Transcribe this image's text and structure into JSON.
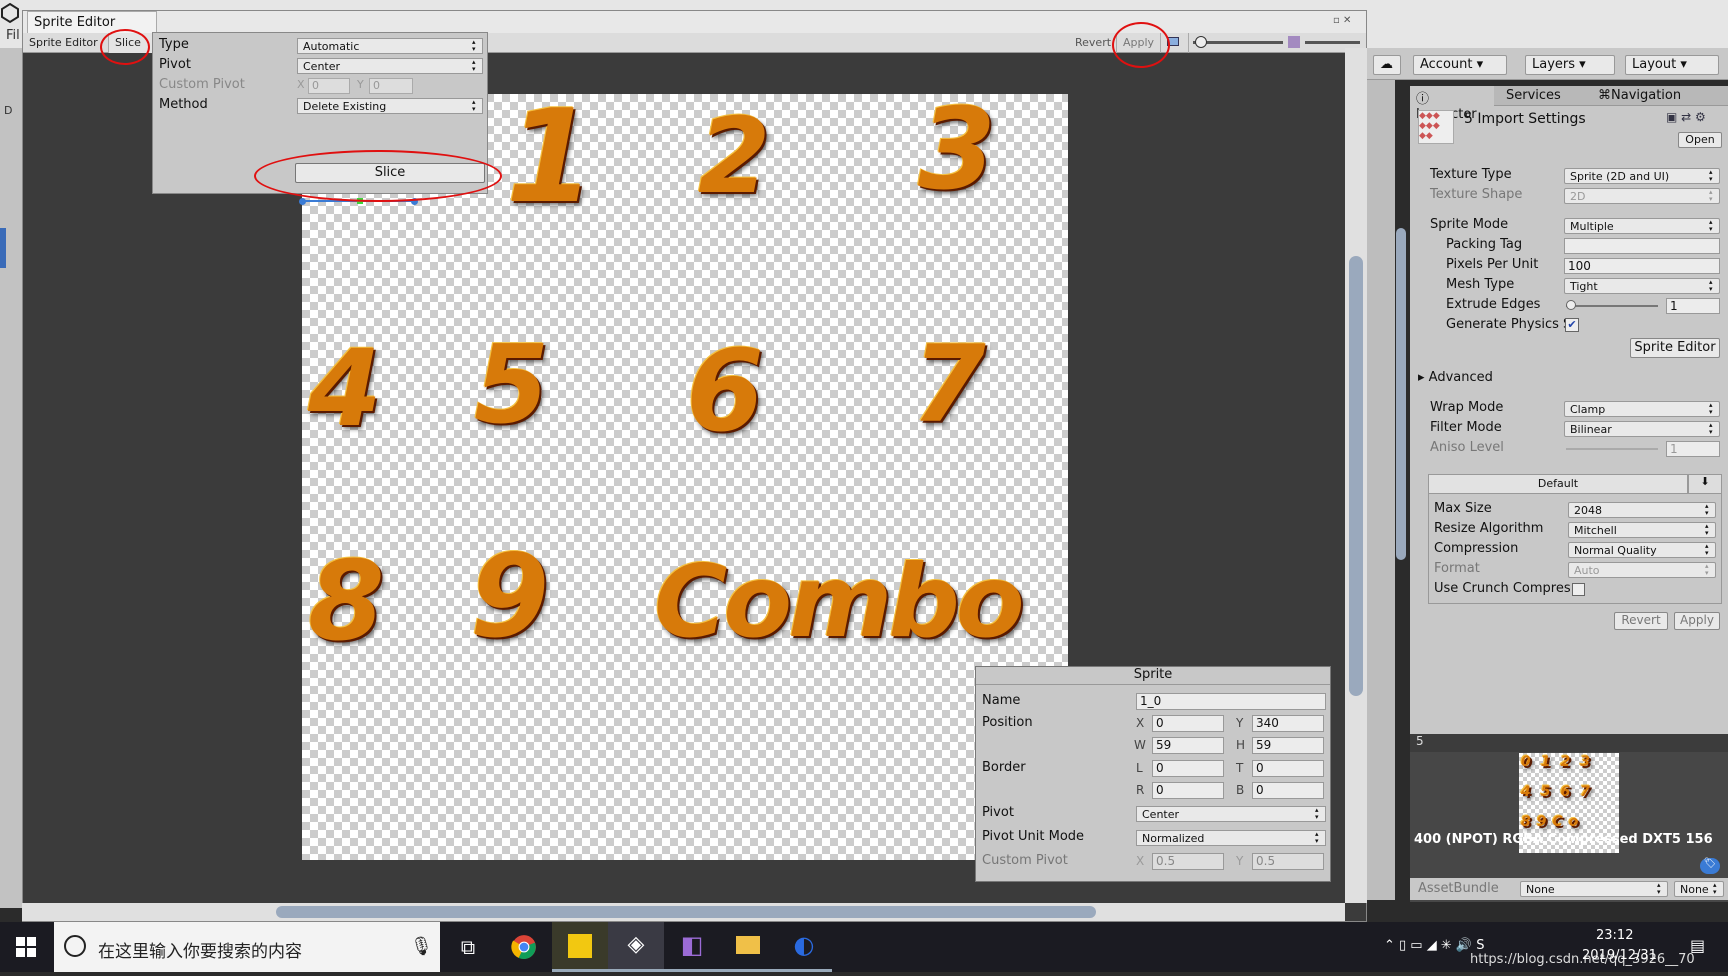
{
  "app": {
    "file_menu": "Fil",
    "left_strip_label": "D"
  },
  "sprite_editor": {
    "title": "Sprite Editor",
    "toolbar": {
      "sprite_editor_label": "Sprite Editor",
      "slice_label": "Slice",
      "revert_label": "Revert",
      "apply_label": "Apply"
    },
    "slice_popup": {
      "type_label": "Type",
      "type_value": "Automatic",
      "pivot_label": "Pivot",
      "pivot_value": "Center",
      "custom_pivot_label": "Custom Pivot",
      "custom_x_label": "X",
      "custom_x_value": "0",
      "custom_y_label": "Y",
      "custom_y_value": "0",
      "method_label": "Method",
      "method_value": "Delete Existing",
      "slice_button": "Slice"
    },
    "canvas": {
      "glyphs": [
        "1",
        "2",
        "3",
        "4",
        "5",
        "6",
        "7",
        "8",
        "9",
        "Combo"
      ]
    },
    "sprite_panel": {
      "title": "Sprite",
      "name_label": "Name",
      "name_value": "1_0",
      "position_label": "Position",
      "x_label": "X",
      "x_value": "0",
      "y_label": "Y",
      "y_value": "340",
      "w_label": "W",
      "w_value": "59",
      "h_label": "H",
      "h_value": "59",
      "border_label": "Border",
      "l_label": "L",
      "l_value": "0",
      "t_label": "T",
      "t_value": "0",
      "r_label": "R",
      "r_value": "0",
      "b_label": "B",
      "b_value": "0",
      "pivot_label": "Pivot",
      "pivot_value": "Center",
      "pivot_unit_label": "Pivot Unit Mode",
      "pivot_unit_value": "Normalized",
      "custom_pivot_label": "Custom Pivot",
      "cp_x_label": "X",
      "cp_x_value": "0.5",
      "cp_y_label": "Y",
      "cp_y_value": "0.5"
    }
  },
  "right_toolbar": {
    "account": "Account",
    "layers": "Layers",
    "layout": "Layout"
  },
  "inspector": {
    "tabs": [
      "Inspector",
      "Services",
      "Navigation"
    ],
    "header_title": "5 Import Settings",
    "open_button": "Open",
    "texture_type_label": "Texture Type",
    "texture_type_value": "Sprite (2D and UI)",
    "texture_shape_label": "Texture Shape",
    "texture_shape_value": "2D",
    "sprite_mode_label": "Sprite Mode",
    "sprite_mode_value": "Multiple",
    "packing_tag_label": "Packing Tag",
    "packing_tag_value": "",
    "ppu_label": "Pixels Per Unit",
    "ppu_value": "100",
    "mesh_type_label": "Mesh Type",
    "mesh_type_value": "Tight",
    "extrude_label": "Extrude Edges",
    "extrude_value": "1",
    "gen_physics_label": "Generate Physics S",
    "sprite_editor_button": "Sprite Editor",
    "advanced_label": "Advanced",
    "wrap_label": "Wrap Mode",
    "wrap_value": "Clamp",
    "filter_label": "Filter Mode",
    "filter_value": "Bilinear",
    "aniso_label": "Aniso Level",
    "aniso_value": "1",
    "platform_tab": "Default",
    "max_size_label": "Max Size",
    "max_size_value": "2048",
    "resize_label": "Resize Algorithm",
    "resize_value": "Mitchell",
    "compression_label": "Compression",
    "compression_value": "Normal Quality",
    "format_label": "Format",
    "format_value": "Auto",
    "crunch_label": "Use Crunch Compres",
    "revert_button": "Revert",
    "apply_button": "Apply",
    "preview_title": "5",
    "preview_info": "400 (NPOT)  RGBA Compressed DXT5  156",
    "assetbundle_label": "AssetBundle",
    "assetbundle_value": "None",
    "assetbundle_variant": "None"
  },
  "taskbar": {
    "search_placeholder": "在这里输入你要搜索的内容",
    "time": "23:12",
    "date": "2019/12/31",
    "watermark": "https://blog.csdn.net/qq_3926__70"
  },
  "colors": {
    "annotation_red": "#e01010",
    "glyph_orange": "#d77a0a",
    "scroll_thumb": "#9aa9bd"
  }
}
